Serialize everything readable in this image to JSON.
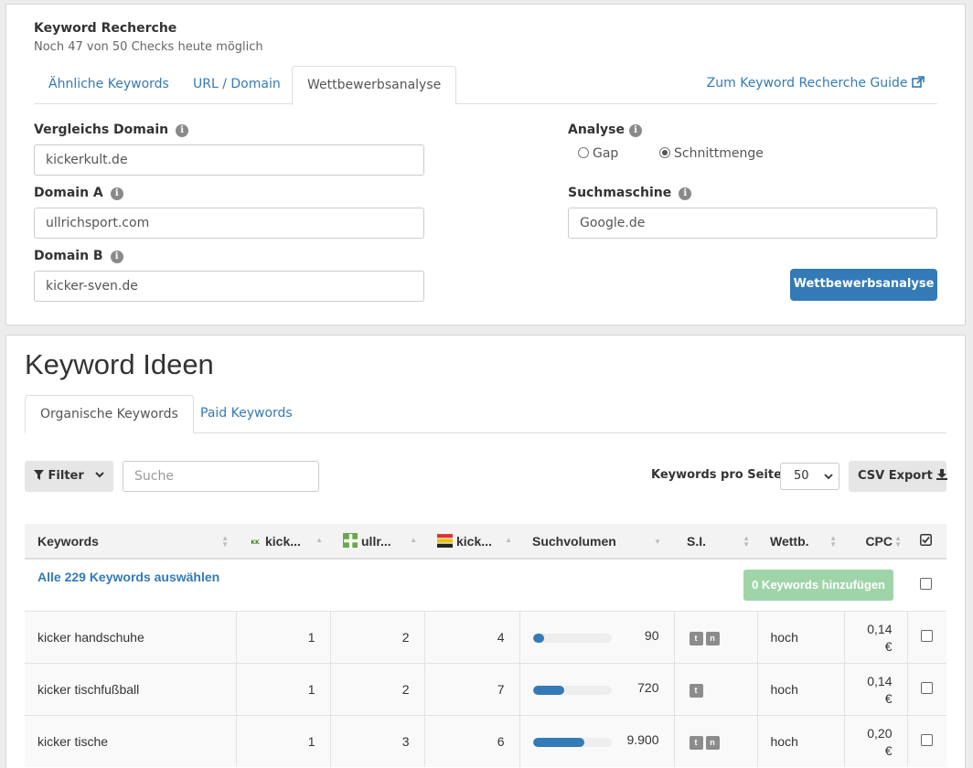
{
  "tool": {
    "title": "Keyword Recherche",
    "checks_info": "Noch 47 von 50 Checks heute möglich",
    "tabs": [
      {
        "label": "Ähnliche Keywords"
      },
      {
        "label": "URL / Domain"
      },
      {
        "label": "Wettbewerbsanalyse"
      }
    ],
    "active_tab": "Wettbewerbsanalyse",
    "guide_link": "Zum Keyword Recherche Guide"
  },
  "form": {
    "compare_label": "Vergleichs Domain",
    "compare_value": "kickerkult.de",
    "domain_a_label": "Domain A",
    "domain_a_value": "ullrichsport.com",
    "domain_b_label": "Domain B",
    "domain_b_value": "kicker-sven.de",
    "analysis_label": "Analyse",
    "analysis_options": [
      {
        "label": "Gap",
        "selected": false
      },
      {
        "label": "Schnittmenge",
        "selected": true
      }
    ],
    "search_engine_label": "Suchmaschine",
    "search_engine_value": "Google.de",
    "submit_label": "Wettbewerbsanalyse"
  },
  "ideas": {
    "heading": "Keyword Ideen",
    "tabs": [
      {
        "label": "Organische Keywords"
      },
      {
        "label": "Paid Keywords"
      }
    ],
    "active_tab": "Organische Keywords",
    "filter_label": "Filter",
    "search_placeholder": "Suche",
    "per_page_label": "Keywords pro Seite:",
    "per_page_value": "50",
    "csv_label": "CSV Export",
    "columns": [
      "Keywords",
      "kick...",
      "ullr...",
      "kick...",
      "Suchvolumen",
      "S.I.",
      "Wettb.",
      "CPC"
    ],
    "select_all": "Alle 229 Keywords auswählen",
    "add_button": "0 Keywords hinzufügen",
    "rows": [
      {
        "keyword": "kicker handschuhe",
        "r1": "1",
        "r2": "2",
        "r3": "4",
        "volume": "90",
        "volume_level": 0.14,
        "si": [
          "t",
          "n"
        ],
        "comp": "hoch",
        "cpc": "0,14",
        "currency": "€"
      },
      {
        "keyword": "kicker tischfußball",
        "r1": "1",
        "r2": "2",
        "r3": "7",
        "volume": "720",
        "volume_level": 0.4,
        "si": [
          "t"
        ],
        "comp": "hoch",
        "cpc": "0,14",
        "currency": "€"
      },
      {
        "keyword": "kicker tische",
        "r1": "1",
        "r2": "3",
        "r3": "6",
        "volume": "9.900",
        "volume_level": 0.66,
        "si": [
          "t",
          "n"
        ],
        "comp": "hoch",
        "cpc": "0,20",
        "currency": "€"
      }
    ]
  },
  "colors": {
    "accent": "#337ab7",
    "success_light": "#9fd4a9",
    "badge": "#8c8c8c"
  }
}
